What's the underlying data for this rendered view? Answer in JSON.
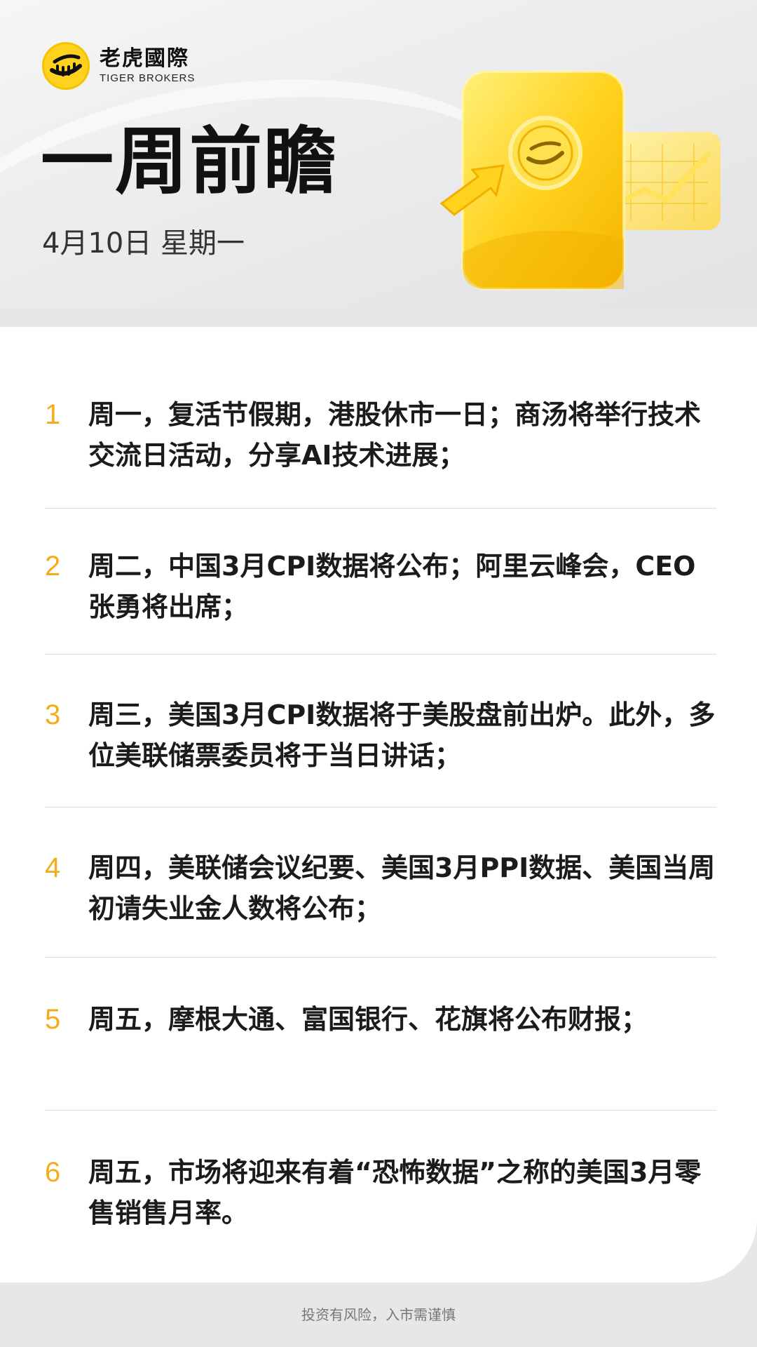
{
  "brand": {
    "name_cn": "老虎國際",
    "name_en": "TIGER BROKERS",
    "accent_color": "#f3ac1b",
    "logo_color": "#ffd21e"
  },
  "header": {
    "title": "一周前瞻",
    "date": "4月10日 星期一",
    "hero_icon": "tiger-card-chart-icon"
  },
  "items": [
    {
      "num": "1",
      "text": "周一，复活节假期，港股休市一日；商汤将举行技术交流日活动，分享AI技术进展；"
    },
    {
      "num": "2",
      "text": "周二，中国3月CPI数据将公布；阿里云峰会，CEO张勇将出席；"
    },
    {
      "num": "3",
      "text": "周三，美国3月CPI数据将于美股盘前出炉。此外，多位美联储票委员将于当日讲话；"
    },
    {
      "num": "4",
      "text": "周四，美联储会议纪要、美国3月PPI数据、美国当周初请失业金人数将公布；"
    },
    {
      "num": "5",
      "text": "周五，摩根大通、富国银行、花旗将公布财报；"
    },
    {
      "num": "6",
      "text": "周五，市场将迎来有着“恐怖数据”之称的美国3月零售销售月率。"
    }
  ],
  "footer": {
    "disclaimer": "投资有风险，入市需谨慎"
  }
}
